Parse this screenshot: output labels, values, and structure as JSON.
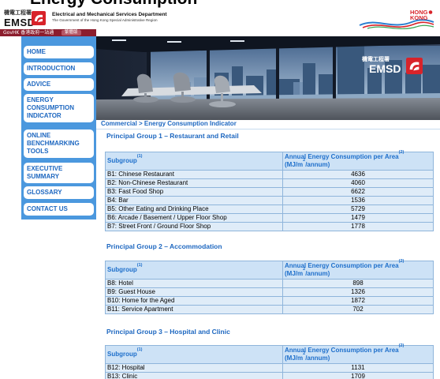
{
  "page_title": "Energy Consumption",
  "header": {
    "logo_chinese": "機電工程署",
    "logo_abbr": "EMSD",
    "dept_name": "Electrical and Mechanical Services Department",
    "dept_sub": "The Government of the Hong Kong Special Administrative Region",
    "brand_top": "HONG",
    "brand_bottom": "KONG"
  },
  "govbar": {
    "govhk": "GovHK 香港政府一站通",
    "lang": "繁體版"
  },
  "nav": [
    {
      "label": "HOME"
    },
    {
      "label": "INTRODUCTION"
    },
    {
      "label": "ADVICE"
    },
    {
      "label": "ENERGY CONSUMPTION INDICATOR"
    },
    {
      "label": "ONLINE BENCHMARKING TOOLS"
    },
    {
      "label": "EXECUTIVE SUMMARY"
    },
    {
      "label": "GLOSSARY"
    },
    {
      "label": "CONTACT US"
    }
  ],
  "banner": {
    "logo_chinese": "機電工程署",
    "logo_abbr": "EMSD"
  },
  "breadcrumb": "Commercial > Energy Consumption Indicator",
  "table_headers": {
    "subgroup": "Subgroup",
    "subgroup_note": "(1)",
    "value": "Annual Energy Consumption per Area",
    "value_note": "(2)",
    "unit_pre": "(MJ/m",
    "unit_sup": "2",
    "unit_post": "/annum)"
  },
  "groups": [
    {
      "title": "Principal Group 1 – Restaurant and Retail",
      "rows": [
        {
          "subgroup": "B1: Chinese Restaurant",
          "value": "4636"
        },
        {
          "subgroup": "B2: Non-Chinese Restaurant",
          "value": "4060"
        },
        {
          "subgroup": "B3: Fast Food Shop",
          "value": "6622"
        },
        {
          "subgroup": "B4: Bar",
          "value": "1536"
        },
        {
          "subgroup": "B5: Other Eating and Drinking Place",
          "value": "5729"
        },
        {
          "subgroup": "B6: Arcade / Basement / Upper Floor Shop",
          "value": "1479"
        },
        {
          "subgroup": "B7: Street Front / Ground Floor Shop",
          "value": "1778"
        }
      ]
    },
    {
      "title": "Principal Group 2 – Accommodation",
      "rows": [
        {
          "subgroup": "B8: Hotel",
          "value": "898"
        },
        {
          "subgroup": "B9: Guest House",
          "value": "1326"
        },
        {
          "subgroup": "B10: Home for the Aged",
          "value": "1872"
        },
        {
          "subgroup": "B11: Service Apartment",
          "value": "702"
        }
      ]
    },
    {
      "title": "Principal Group 3 – Hospital and Clinic",
      "rows": [
        {
          "subgroup": "B12: Hospital",
          "value": "1131"
        },
        {
          "subgroup": "B13: Clinic",
          "value": "1709"
        }
      ]
    }
  ],
  "colors": {
    "nav_bg": "#4b98de",
    "link_blue": "#1d67c0",
    "header_bar": "#8c1d2d",
    "table_header_bg": "#cde2f6",
    "table_row_bg": "#dfecf8",
    "emsd_red": "#d8232a"
  }
}
